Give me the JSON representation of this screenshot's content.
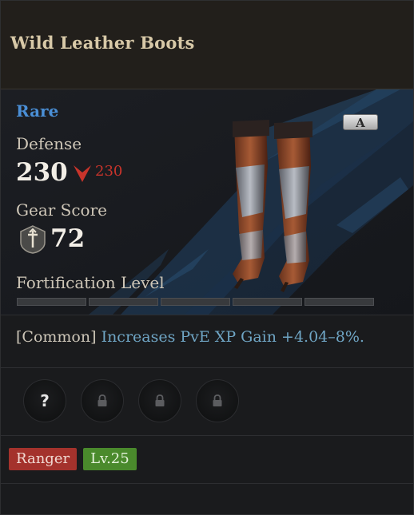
{
  "item": {
    "name": "Wild Leather Boots",
    "rarity": "Rare",
    "grade": "A",
    "image_icon": "leather-boots-icon"
  },
  "stats": {
    "defense_label": "Defense",
    "defense_value": "230",
    "defense_compare_icon": "down-arrow-icon",
    "defense_compare_value": "230",
    "gear_score_label": "Gear Score",
    "gear_score_icon": "sword-shield-icon",
    "gear_score_value": "72",
    "fortification_label": "Fortification Level",
    "fortification_segments": 5,
    "fortification_filled": 0
  },
  "effect": {
    "prefix": "[Common]",
    "text": "Increases PvE XP Gain +4.04–8%."
  },
  "sockets": [
    {
      "state": "unknown",
      "icon": "question-icon",
      "glyph": "?"
    },
    {
      "state": "locked",
      "icon": "lock-icon"
    },
    {
      "state": "locked",
      "icon": "lock-icon"
    },
    {
      "state": "locked",
      "icon": "lock-icon"
    }
  ],
  "requirements": {
    "class": "Ranger",
    "level": "Lv.25"
  },
  "colors": {
    "rarity": "#4a8fd6",
    "compare_down": "#c8342b",
    "effect_text": "#6fa5c4",
    "class_tag": "#a4322c",
    "level_tag": "#4a8a2c"
  }
}
